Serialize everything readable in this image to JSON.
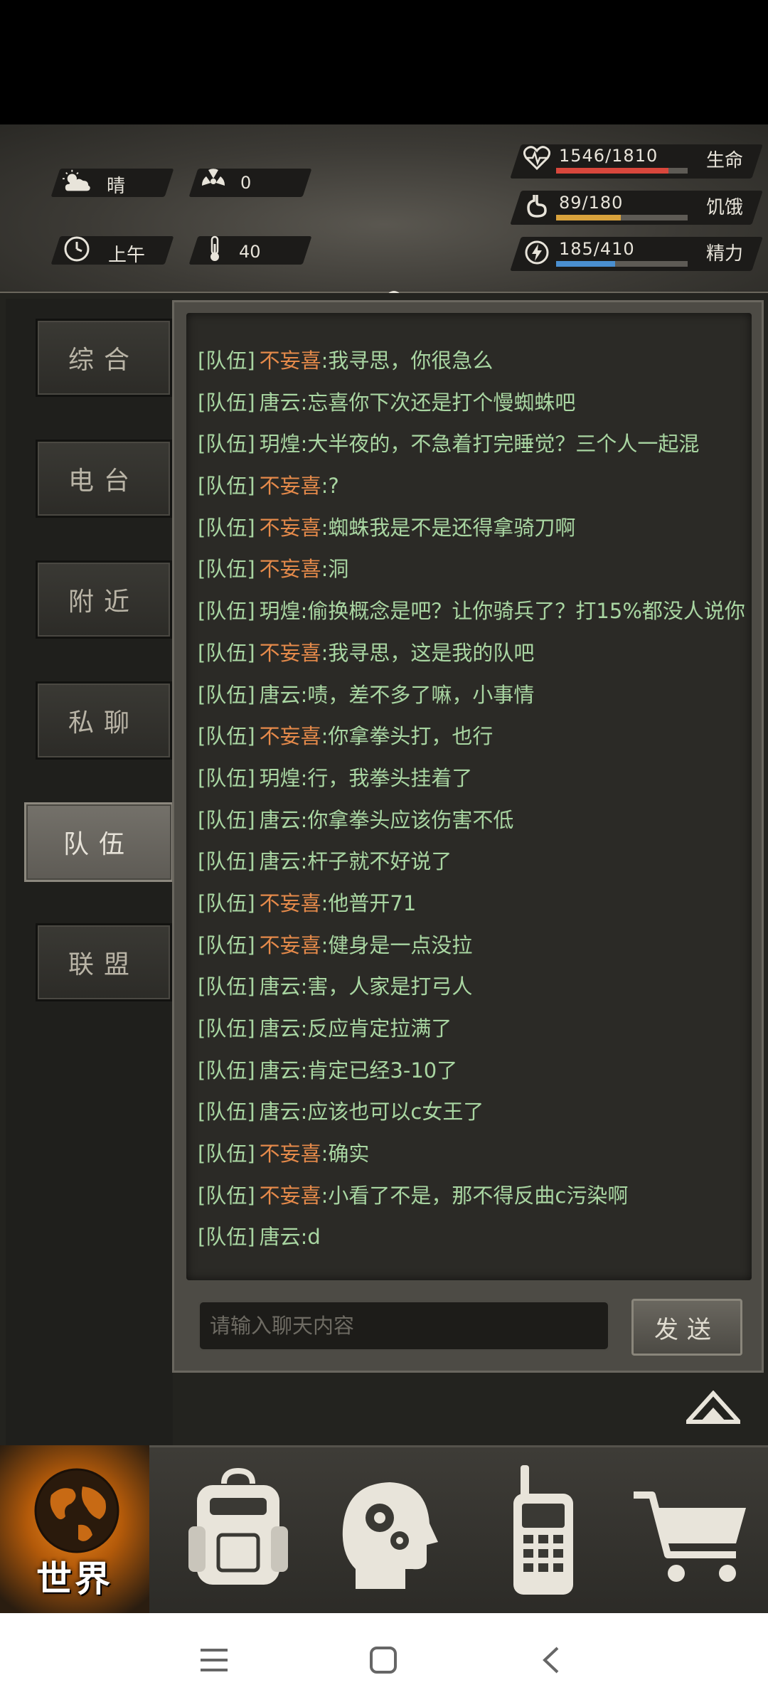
{
  "hud": {
    "weather": "晴",
    "radiation": "0",
    "time_of_day": "上午",
    "temperature": "40",
    "health": {
      "value": "1546/1810",
      "label": "生命",
      "fraction": 0.854,
      "color": "#d8473c"
    },
    "hunger": {
      "value": "89/180",
      "label": "饥饿",
      "fraction": 0.494,
      "color": "#d9a23c"
    },
    "energy": {
      "value": "185/410",
      "label": "精力",
      "fraction": 0.451,
      "color": "#4a8fd0"
    }
  },
  "sidebar": {
    "tabs": [
      "综合",
      "电台",
      "附近",
      "私聊",
      "队伍",
      "联盟"
    ],
    "active": "队伍"
  },
  "chat": {
    "channel_tag": "[队伍]",
    "messages": [
      {
        "name": "不妄喜",
        "text": ":我寻思，你很急么",
        "color": "orange"
      },
      {
        "name": "唐云",
        "text": ":忘喜你下次还是打个慢蜘蛛吧",
        "color": "green"
      },
      {
        "name": "玥煌",
        "text": ":大半夜的，不急着打完睡觉？三个人一起混",
        "color": "green"
      },
      {
        "name": "不妄喜",
        "text": ":?",
        "color": "orange"
      },
      {
        "name": "不妄喜",
        "text": ":蜘蛛我是不是还得拿骑刀啊",
        "color": "orange"
      },
      {
        "name": "不妄喜",
        "text": ":洞",
        "color": "orange"
      },
      {
        "name": "玥煌",
        "text": ":偷换概念是吧？让你骑兵了？打15%都没人说你",
        "color": "green"
      },
      {
        "name": "不妄喜",
        "text": ":我寻思，这是我的队吧",
        "color": "orange"
      },
      {
        "name": "唐云",
        "text": ":啧，差不多了嘛，小事情",
        "color": "green"
      },
      {
        "name": "不妄喜",
        "text": ":你拿拳头打，也行",
        "color": "orange"
      },
      {
        "name": "玥煌",
        "text": ":行，我拳头挂着了",
        "color": "green"
      },
      {
        "name": "唐云",
        "text": ":你拿拳头应该伤害不低",
        "color": "green"
      },
      {
        "name": "唐云",
        "text": ":杆子就不好说了",
        "color": "green"
      },
      {
        "name": "不妄喜",
        "text": ":他普开71",
        "color": "orange"
      },
      {
        "name": "不妄喜",
        "text": ":健身是一点没拉",
        "color": "orange"
      },
      {
        "name": "唐云",
        "text": ":害，人家是打弓人",
        "color": "green"
      },
      {
        "name": "唐云",
        "text": ":反应肯定拉满了",
        "color": "green"
      },
      {
        "name": "唐云",
        "text": ":肯定已经3-10了",
        "color": "green"
      },
      {
        "name": "唐云",
        "text": ":应该也可以c女王了",
        "color": "green"
      },
      {
        "name": "不妄喜",
        "text": ":确实",
        "color": "orange"
      },
      {
        "name": "不妄喜",
        "text": ":小看了不是，那不得反曲c污染啊",
        "color": "orange"
      },
      {
        "name": "唐云",
        "text": ":d",
        "color": "green"
      }
    ],
    "input_placeholder": "请输入聊天内容",
    "send_label": "发送"
  },
  "bottom_nav": {
    "world_label": "世界",
    "items": [
      "world-icon",
      "backpack-icon",
      "skills-head-icon",
      "walkie-talkie-icon",
      "shopping-cart-icon"
    ]
  }
}
